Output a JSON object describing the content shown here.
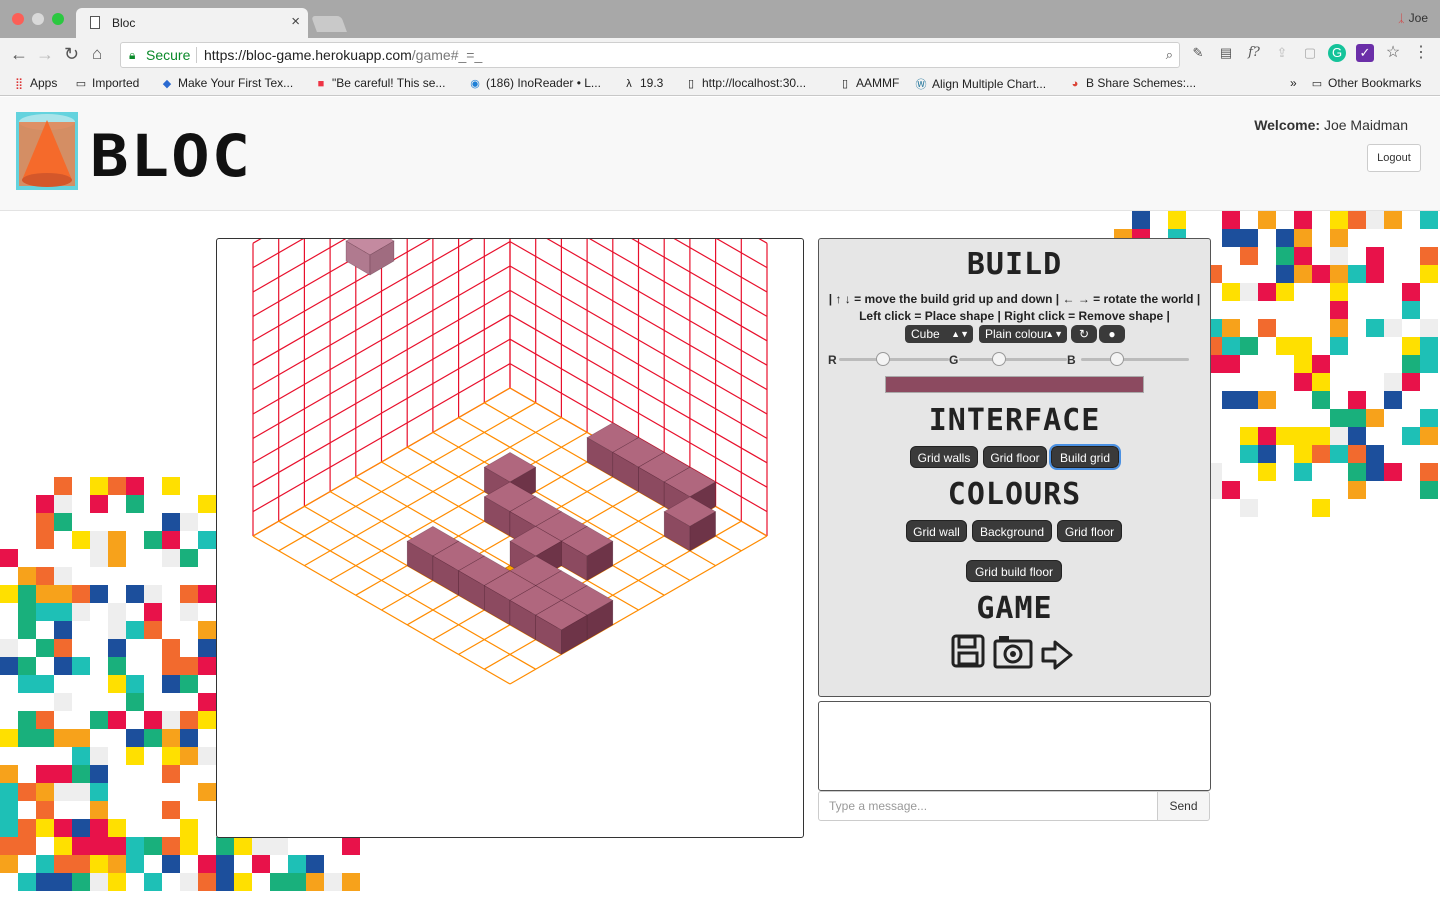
{
  "browser": {
    "tab_title": "Bloc",
    "profile_name": "Joe",
    "secure_label": "Secure",
    "url_main": "https://bloc-game.herokuapp.com",
    "url_path": "/game#_=_",
    "bookmarks": [
      {
        "label": "Apps",
        "icon": "apps-grid-icon"
      },
      {
        "label": "Imported",
        "icon": "folder-icon"
      },
      {
        "label": "Make Your First Tex...",
        "icon": "cube-icon"
      },
      {
        "label": "\"Be careful! This se...",
        "icon": "windows-icon"
      },
      {
        "label": "(186) InoReader • L...",
        "icon": "rss-icon"
      },
      {
        "label": "19.3",
        "icon": "lambda-icon"
      },
      {
        "label": "http://localhost:30...",
        "icon": "page-icon"
      },
      {
        "label": "AAMMF",
        "icon": "page-icon"
      },
      {
        "label": "Align Multiple Chart...",
        "icon": "wordpress-icon"
      },
      {
        "label": "B Share Schemes:...",
        "icon": "chrome-icon"
      }
    ],
    "overflow_label": "»",
    "other_bookmarks": "Other Bookmarks"
  },
  "header": {
    "logo_text": "BLOC",
    "welcome_label": "Welcome:",
    "user_name": "Joe Maidman",
    "logout_label": "Logout"
  },
  "build": {
    "title": "BUILD",
    "instructions_line1": "| ↑ ↓ = move the build grid up and down | ← → = rotate the world |",
    "instructions_line2": "Left click = Place shape | Right click = Remove shape |",
    "shape_select": "Cube",
    "colour_select": "Plain colour",
    "rgb_labels": [
      "R",
      "G",
      "B"
    ],
    "rgb_values": [
      0.4,
      0.37,
      0.33
    ],
    "current_colour": "#8c4a60"
  },
  "interface": {
    "title": "INTERFACE",
    "buttons": [
      "Grid walls",
      "Grid floor",
      "Build grid"
    ],
    "active": "Build grid"
  },
  "colours": {
    "title": "COLOURS",
    "buttons": [
      "Grid wall",
      "Background",
      "Grid floor"
    ],
    "button_extra": "Grid build floor"
  },
  "game": {
    "title": "GAME",
    "icons": [
      "save-icon",
      "camera-icon",
      "exit-icon"
    ]
  },
  "chat": {
    "placeholder": "Type a message...",
    "send_label": "Send"
  },
  "colors": {
    "grid_wall": "#e8102c",
    "grid_floor": "#ff8c00",
    "block_top": "#b0677e",
    "block_left": "#8c4a60",
    "block_right": "#6e3448",
    "highlight": "#ffa500"
  }
}
